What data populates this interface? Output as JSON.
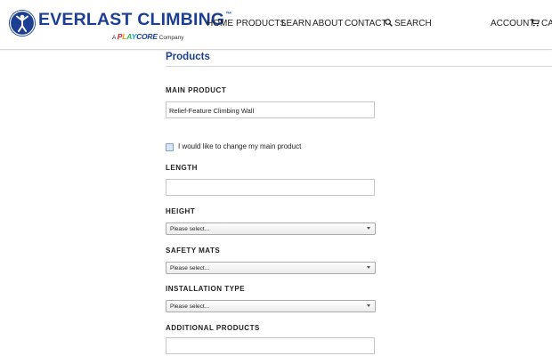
{
  "brand": {
    "name": "EVERLAST CLIMBING",
    "tm": "™",
    "sub_prefix": "A",
    "sub_brand": {
      "p": "P",
      "l": "L",
      "a": "A",
      "y": "Y",
      "core": "CORE"
    },
    "sub_suffix": "Company",
    "primary_color": "#1c3f94"
  },
  "nav": {
    "home": "HOME",
    "products": "PRODUCTS",
    "learn": "LEARN",
    "about": "ABOUT",
    "contact": "CONTACT",
    "search": "SEARCH",
    "account": "ACCOUNT",
    "cart": "CA"
  },
  "section": {
    "title": "Products"
  },
  "form": {
    "main_product": {
      "label": "MAIN PRODUCT",
      "value": "Relief-Feature Climbing Wall"
    },
    "change_checkbox": {
      "label": "I would like to change my main product",
      "checked": false
    },
    "length": {
      "label": "LENGTH",
      "value": ""
    },
    "height": {
      "label": "HEIGHT",
      "selected": "Please select..."
    },
    "safety_mats": {
      "label": "SAFETY MATS",
      "selected": "Please select..."
    },
    "installation_type": {
      "label": "INSTALLATION TYPE",
      "selected": "Please select..."
    },
    "additional_products": {
      "label": "ADDITIONAL PRODUCTS",
      "value": ""
    }
  },
  "icons": [
    "climber-logo-icon",
    "search-icon",
    "cart-icon",
    "chevron-down-icon"
  ]
}
